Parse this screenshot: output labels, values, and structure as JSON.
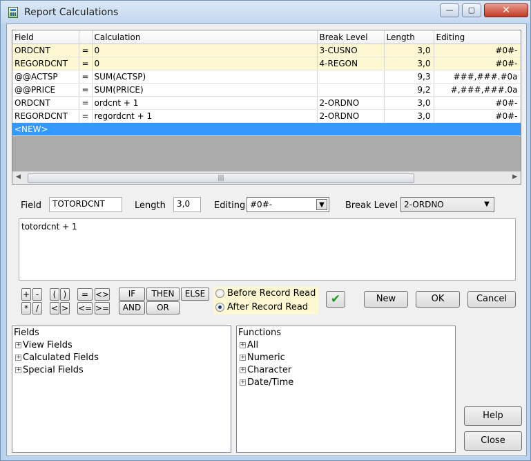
{
  "window": {
    "title": "Report Calculations",
    "min_glyph": "—",
    "max_glyph": "▢",
    "close_glyph": "✕"
  },
  "grid": {
    "columns": [
      "Field",
      "",
      "Calculation",
      "Break Level",
      "Length",
      "Editing"
    ],
    "rows": [
      {
        "field": "ORDCNT",
        "op": "=",
        "calc": "0",
        "break": "3-CUSNO",
        "length": "3,0",
        "editing": "#0#-",
        "highlight": true
      },
      {
        "field": "REGORDCNT",
        "op": "=",
        "calc": "0",
        "break": "4-REGON",
        "length": "3,0",
        "editing": "#0#-",
        "highlight": true
      },
      {
        "field": "@@ACTSP",
        "op": "=",
        "calc": "SUM(ACTSP)",
        "break": "",
        "length": "9,3",
        "editing": "###,###.#0a",
        "highlight": false
      },
      {
        "field": "@@PRICE",
        "op": "=",
        "calc": "SUM(PRICE)",
        "break": "",
        "length": "9,2",
        "editing": "#,###,###.0a",
        "highlight": false
      },
      {
        "field": "ORDCNT",
        "op": "=",
        "calc": "ordcnt + 1",
        "break": "2-ORDNO",
        "length": "3,0",
        "editing": "#0#-",
        "highlight": false
      },
      {
        "field": "REGORDCNT",
        "op": "=",
        "calc": "regordcnt + 1",
        "break": "2-ORDNO",
        "length": "3,0",
        "editing": "#0#-",
        "highlight": false
      }
    ],
    "new_row_label": "<NEW>",
    "scroll_left": "◀",
    "scroll_right": "▶",
    "scroll_grip": "|||"
  },
  "form": {
    "field_label": "Field",
    "field_value": "TOTORDCNT",
    "length_label": "Length",
    "length_value": "3,0",
    "editing_label": "Editing",
    "editing_value": "#0#-",
    "break_label": "Break Level",
    "break_value": "2-ORDNO",
    "formula": "totordcnt + 1",
    "dropdown_glyph": "▼"
  },
  "operators": {
    "plus": "+",
    "minus": "-",
    "lparen": "(",
    "rparen": ")",
    "eq": "=",
    "ne": "<>",
    "mul": "*",
    "div": "/",
    "lt": "<",
    "gt": ">",
    "le": "<=",
    "ge": ">=",
    "if": "IF",
    "then": "THEN",
    "else": "ELSE",
    "and": "AND",
    "or": "OR"
  },
  "timing": {
    "before": "Before Record Read",
    "after": "After Record Read",
    "selected": "after"
  },
  "buttons": {
    "check": "✔",
    "new": "New",
    "ok": "OK",
    "cancel": "Cancel",
    "help": "Help",
    "close": "Close"
  },
  "fields_tree": {
    "header": "Fields",
    "items": [
      "View Fields",
      "Calculated Fields",
      "Special Fields"
    ]
  },
  "functions_tree": {
    "header": "Functions",
    "items": [
      "All",
      "Numeric",
      "Character",
      "Date/Time"
    ]
  },
  "expand_glyph": "+",
  "colors": {
    "highlight_row": "#fdf8d2",
    "selection": "#3399ff",
    "radio_bg": "#fdf8d2"
  }
}
